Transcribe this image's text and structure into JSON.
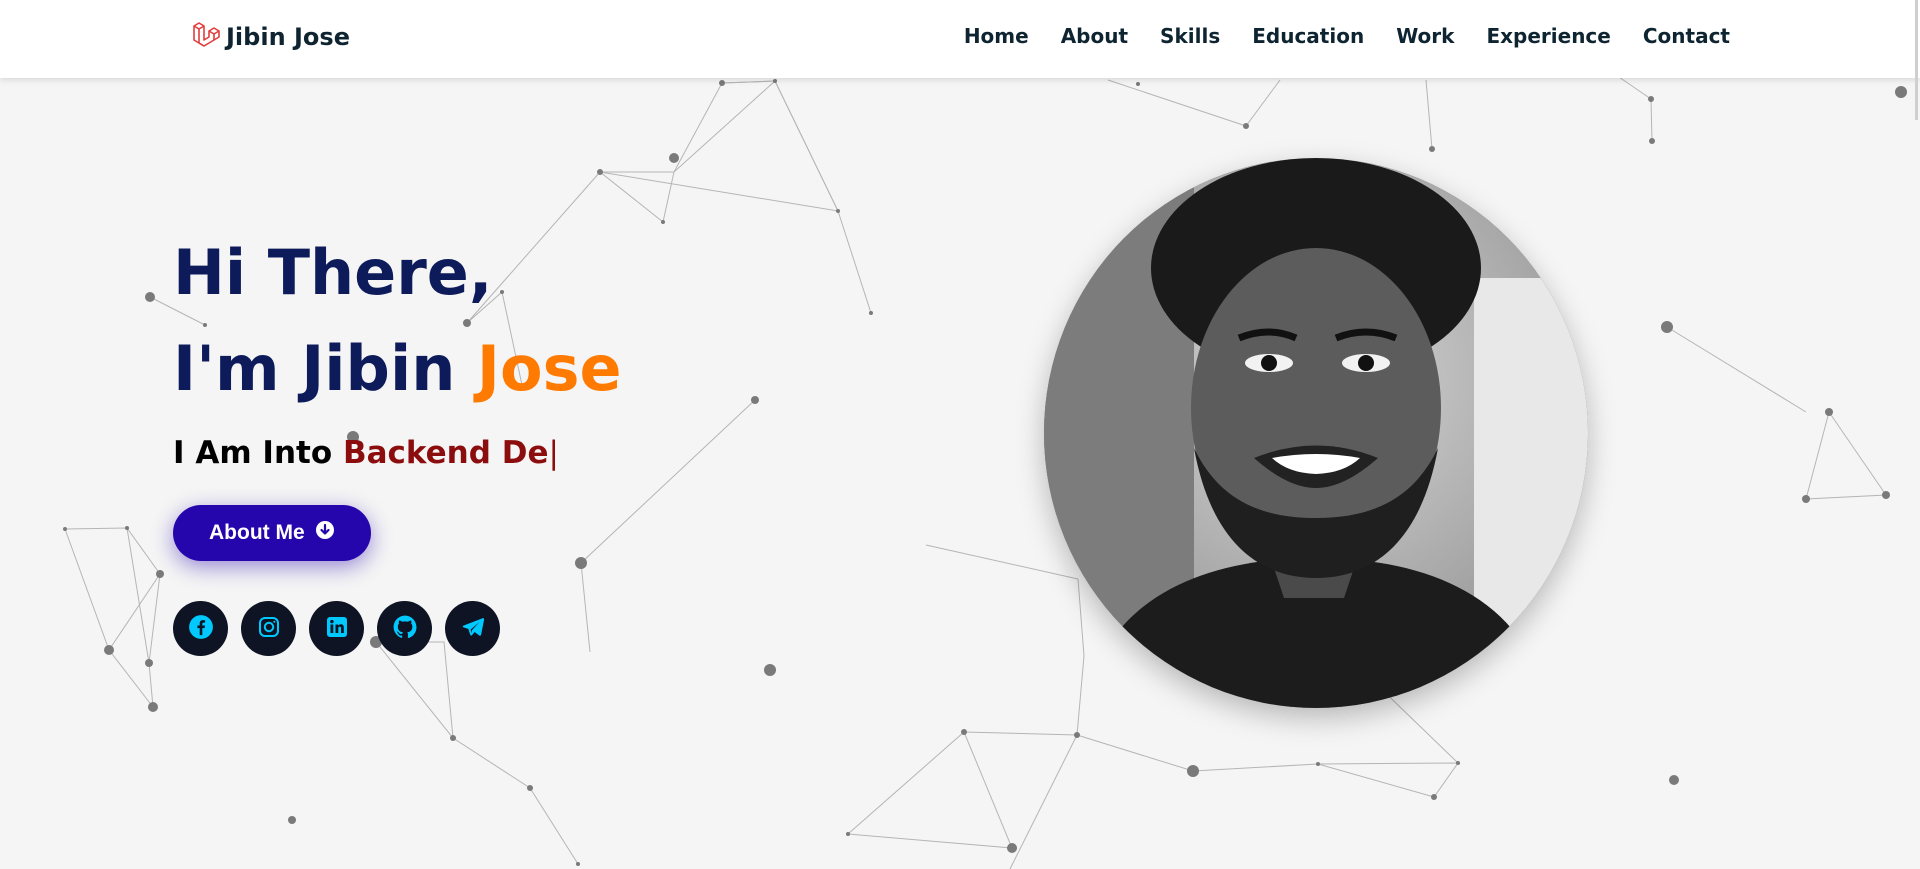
{
  "brand": {
    "name": "Jibin Jose",
    "icon": "laravel-logo-icon"
  },
  "nav": {
    "items": [
      "Home",
      "About",
      "Skills",
      "Education",
      "Work",
      "Experience",
      "Contact"
    ]
  },
  "hero": {
    "line1": "Hi There,",
    "line2_first": "I'm Jibin ",
    "line2_accent": "Jose",
    "typing_prefix": "I Am Into ",
    "typing_text": "Backend De",
    "cursor": "|",
    "button_label": "About Me",
    "button_icon": "arrow-down-circle-icon"
  },
  "socials": [
    {
      "name": "facebook",
      "icon": "facebook-icon"
    },
    {
      "name": "instagram",
      "icon": "instagram-icon"
    },
    {
      "name": "linkedin",
      "icon": "linkedin-icon"
    },
    {
      "name": "github",
      "icon": "github-icon"
    },
    {
      "name": "telegram",
      "icon": "telegram-icon"
    }
  ],
  "profile_image": {
    "alt": "profile-photo"
  },
  "colors": {
    "primary_dark": "#0d1b5a",
    "accent_orange": "#ff7a00",
    "typed_red": "#8b0d0d",
    "button_blue": "#2506ad",
    "social_bg": "#0e1423",
    "social_icon": "#00c9ff",
    "logo_red": "#e23d3d"
  }
}
